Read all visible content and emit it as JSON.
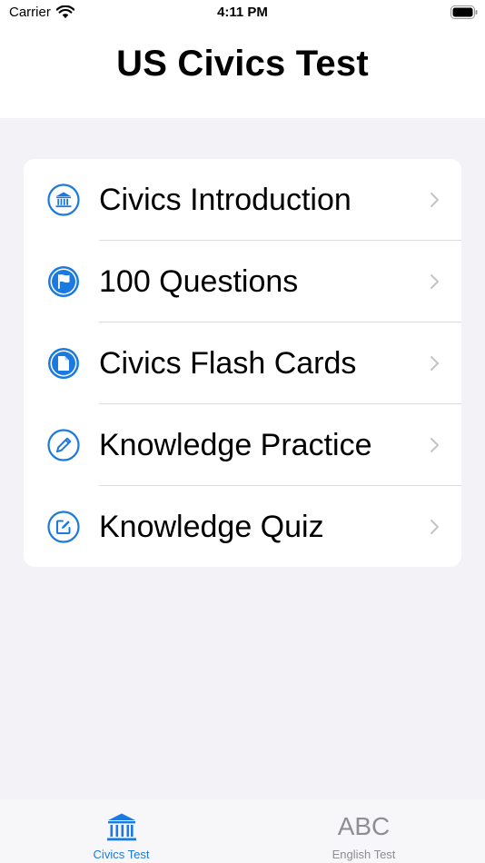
{
  "status_bar": {
    "carrier": "Carrier",
    "time": "4:11 PM"
  },
  "header": {
    "title": "US Civics Test"
  },
  "menu": {
    "items": [
      {
        "label": "Civics Introduction",
        "icon": "building-columns-icon"
      },
      {
        "label": "100 Questions",
        "icon": "flag-icon"
      },
      {
        "label": "Civics Flash Cards",
        "icon": "document-icon"
      },
      {
        "label": "Knowledge Practice",
        "icon": "pencil-icon"
      },
      {
        "label": "Knowledge Quiz",
        "icon": "square-pencil-icon"
      }
    ]
  },
  "tabbar": {
    "tabs": [
      {
        "label": "Civics Test",
        "icon": "building-columns-icon",
        "selected": true
      },
      {
        "label": "English Test",
        "icon_text": "ABC",
        "selected": false
      }
    ]
  },
  "colors": {
    "accent": "#1a7ae0",
    "inactive": "#8e8e93",
    "background": "#f2f2f7"
  }
}
